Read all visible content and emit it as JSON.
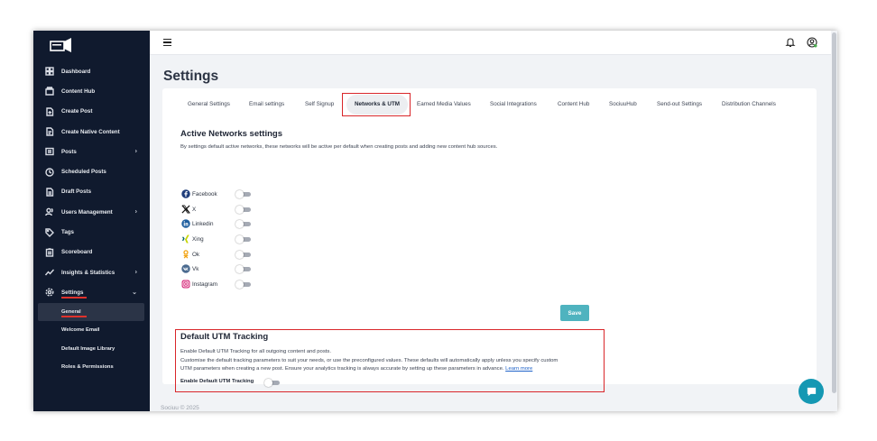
{
  "sidebar": {
    "items": [
      {
        "label": "Dashboard",
        "icon": "dashboard-icon"
      },
      {
        "label": "Content Hub",
        "icon": "folder-icon"
      },
      {
        "label": "Create Post",
        "icon": "file-plus-icon"
      },
      {
        "label": "Create Native Content",
        "icon": "file-edit-icon"
      },
      {
        "label": "Posts",
        "icon": "posts-icon",
        "chevron": "›"
      },
      {
        "label": "Scheduled Posts",
        "icon": "clock-icon"
      },
      {
        "label": "Draft Posts",
        "icon": "draft-icon"
      },
      {
        "label": "Users Management",
        "icon": "users-icon",
        "chevron": "›"
      },
      {
        "label": "Tags",
        "icon": "tag-icon"
      },
      {
        "label": "Scoreboard",
        "icon": "clipboard-icon"
      },
      {
        "label": "Insights & Statistics",
        "icon": "chart-line-icon",
        "chevron": "›"
      },
      {
        "label": "Settings",
        "icon": "gear-icon",
        "chevron": "⌄"
      }
    ],
    "sub_items": [
      {
        "label": "General"
      },
      {
        "label": "Welcome Email"
      },
      {
        "label": "Default Image Library"
      },
      {
        "label": "Roles & Permissions"
      }
    ]
  },
  "page": {
    "title": "Settings"
  },
  "tabs": [
    {
      "label": "General Settings"
    },
    {
      "label": "Email settings"
    },
    {
      "label": "Self Signup"
    },
    {
      "label": "Networks & UTM"
    },
    {
      "label": "Earned Media Values"
    },
    {
      "label": "Social Integrations"
    },
    {
      "label": "Content Hub"
    },
    {
      "label": "SociuuHub"
    },
    {
      "label": "Send-out Settings"
    },
    {
      "label": "Distribution Channels"
    }
  ],
  "networks": {
    "title": "Active Networks settings",
    "description": "By settings default active networks, these networks will be active per default when creating posts and adding new content hub sources.",
    "items": [
      {
        "label": "Facebook",
        "icon": "facebook-icon",
        "enabled": false
      },
      {
        "label": "X",
        "icon": "x-icon",
        "enabled": false
      },
      {
        "label": "Linkedin",
        "icon": "linkedin-icon",
        "enabled": false
      },
      {
        "label": "Xing",
        "icon": "xing-icon",
        "enabled": false
      },
      {
        "label": "Ok",
        "icon": "ok-icon",
        "enabled": false
      },
      {
        "label": "Vk",
        "icon": "vk-icon",
        "enabled": false
      },
      {
        "label": "Instagram",
        "icon": "instagram-icon",
        "enabled": false
      }
    ],
    "save_label": "Save"
  },
  "utm": {
    "title": "Default UTM Tracking",
    "line1": "Enable Default UTM Tracking for all outgoing content and posts.",
    "line2": "Customise the default tracking parameters to suit your needs, or use the preconfigured values. These defaults will automatically apply unless you specify custom",
    "line3": "UTM parameters when creating a new post. Ensure your analytics tracking is always accurate by setting up these parameters in advance.",
    "learn_more": "Learn more",
    "enable_label": "Enable Default UTM Tracking",
    "enabled": false
  },
  "footer": {
    "text": "Sociuu © 2025"
  },
  "colors": {
    "sidebar_bg": "#101a2e",
    "accent_red": "#d9262a",
    "save_button": "#4fb3bf",
    "chat_button": "#1598b3",
    "link": "#2063c9"
  }
}
